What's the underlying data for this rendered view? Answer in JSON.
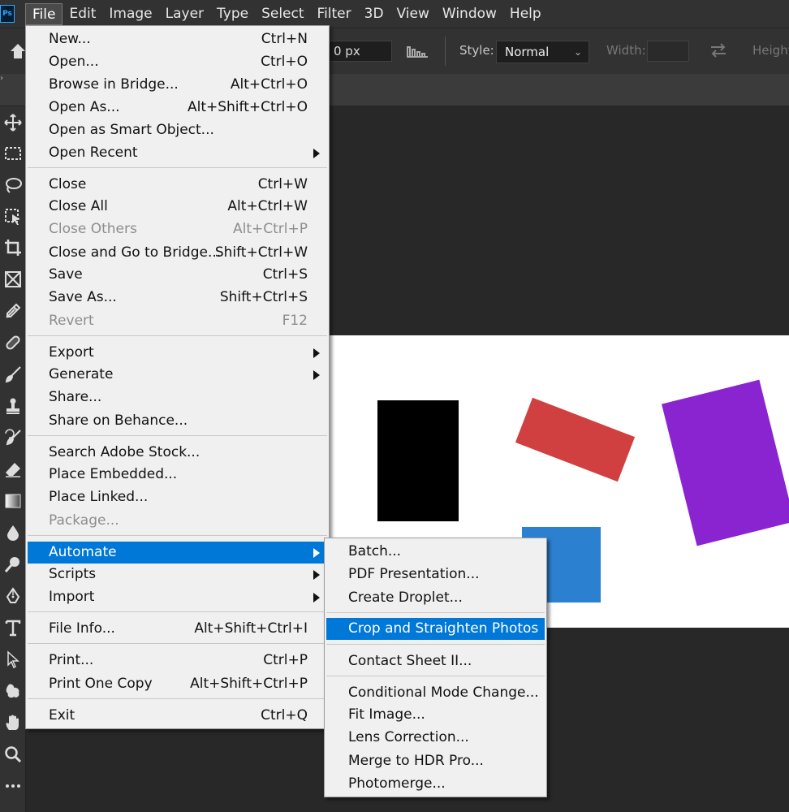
{
  "app": {
    "logo": "Ps"
  },
  "menubar": [
    "File",
    "Edit",
    "Image",
    "Layer",
    "Type",
    "Select",
    "Filter",
    "3D",
    "View",
    "Window",
    "Help"
  ],
  "options": {
    "feather_value": "0 px",
    "style_label": "Style:",
    "style_value": "Normal",
    "width_label": "Width:",
    "height_label": "Height:"
  },
  "tools": [
    "move-icon",
    "marquee-icon",
    "lasso-icon",
    "object-select-icon",
    "crop-icon",
    "frame-icon",
    "eyedropper-icon",
    "healing-icon",
    "brush-icon",
    "stamp-icon",
    "history-brush-icon",
    "eraser-icon",
    "gradient-icon",
    "blur-icon",
    "dodge-icon",
    "pen-icon",
    "type-icon",
    "path-select-icon",
    "shape-icon",
    "hand-icon",
    "zoom-icon",
    "more-icon"
  ],
  "canvas_shapes": [
    {
      "name": "black-rectangle",
      "color": "#000000"
    },
    {
      "name": "red-rectangle",
      "color": "#d04040"
    },
    {
      "name": "purple-rectangle",
      "color": "#8a24d0"
    },
    {
      "name": "blue-rectangle",
      "color": "#2b80d0"
    }
  ],
  "file_menu": [
    {
      "label": "New...",
      "shortcut": "Ctrl+N"
    },
    {
      "label": "Open...",
      "shortcut": "Ctrl+O"
    },
    {
      "label": "Browse in Bridge...",
      "shortcut": "Alt+Ctrl+O"
    },
    {
      "label": "Open As...",
      "shortcut": "Alt+Shift+Ctrl+O"
    },
    {
      "label": "Open as Smart Object...",
      "shortcut": ""
    },
    {
      "label": "Open Recent",
      "shortcut": "",
      "submenu": true
    },
    {
      "label": "Close",
      "shortcut": "Ctrl+W"
    },
    {
      "label": "Close All",
      "shortcut": "Alt+Ctrl+W"
    },
    {
      "label": "Close Others",
      "shortcut": "Alt+Ctrl+P",
      "disabled": true
    },
    {
      "label": "Close and Go to Bridge...",
      "shortcut": "Shift+Ctrl+W"
    },
    {
      "label": "Save",
      "shortcut": "Ctrl+S"
    },
    {
      "label": "Save As...",
      "shortcut": "Shift+Ctrl+S"
    },
    {
      "label": "Revert",
      "shortcut": "F12",
      "disabled": true
    },
    {
      "label": "Export",
      "shortcut": "",
      "submenu": true
    },
    {
      "label": "Generate",
      "shortcut": "",
      "submenu": true
    },
    {
      "label": "Share...",
      "shortcut": ""
    },
    {
      "label": "Share on Behance...",
      "shortcut": ""
    },
    {
      "label": "Search Adobe Stock...",
      "shortcut": ""
    },
    {
      "label": "Place Embedded...",
      "shortcut": ""
    },
    {
      "label": "Place Linked...",
      "shortcut": ""
    },
    {
      "label": "Package...",
      "shortcut": "",
      "disabled": true
    },
    {
      "label": "Automate",
      "shortcut": "",
      "submenu": true,
      "highlighted": true
    },
    {
      "label": "Scripts",
      "shortcut": "",
      "submenu": true
    },
    {
      "label": "Import",
      "shortcut": "",
      "submenu": true
    },
    {
      "label": "File Info...",
      "shortcut": "Alt+Shift+Ctrl+I"
    },
    {
      "label": "Print...",
      "shortcut": "Ctrl+P"
    },
    {
      "label": "Print One Copy",
      "shortcut": "Alt+Shift+Ctrl+P"
    },
    {
      "label": "Exit",
      "shortcut": "Ctrl+Q"
    }
  ],
  "automate_menu": [
    {
      "label": "Batch..."
    },
    {
      "label": "PDF Presentation..."
    },
    {
      "label": "Create Droplet..."
    },
    {
      "label": "Crop and Straighten Photos",
      "highlighted": true
    },
    {
      "label": "Contact Sheet II..."
    },
    {
      "label": "Conditional Mode Change..."
    },
    {
      "label": "Fit Image..."
    },
    {
      "label": "Lens Correction..."
    },
    {
      "label": "Merge to HDR Pro..."
    },
    {
      "label": "Photomerge..."
    }
  ]
}
